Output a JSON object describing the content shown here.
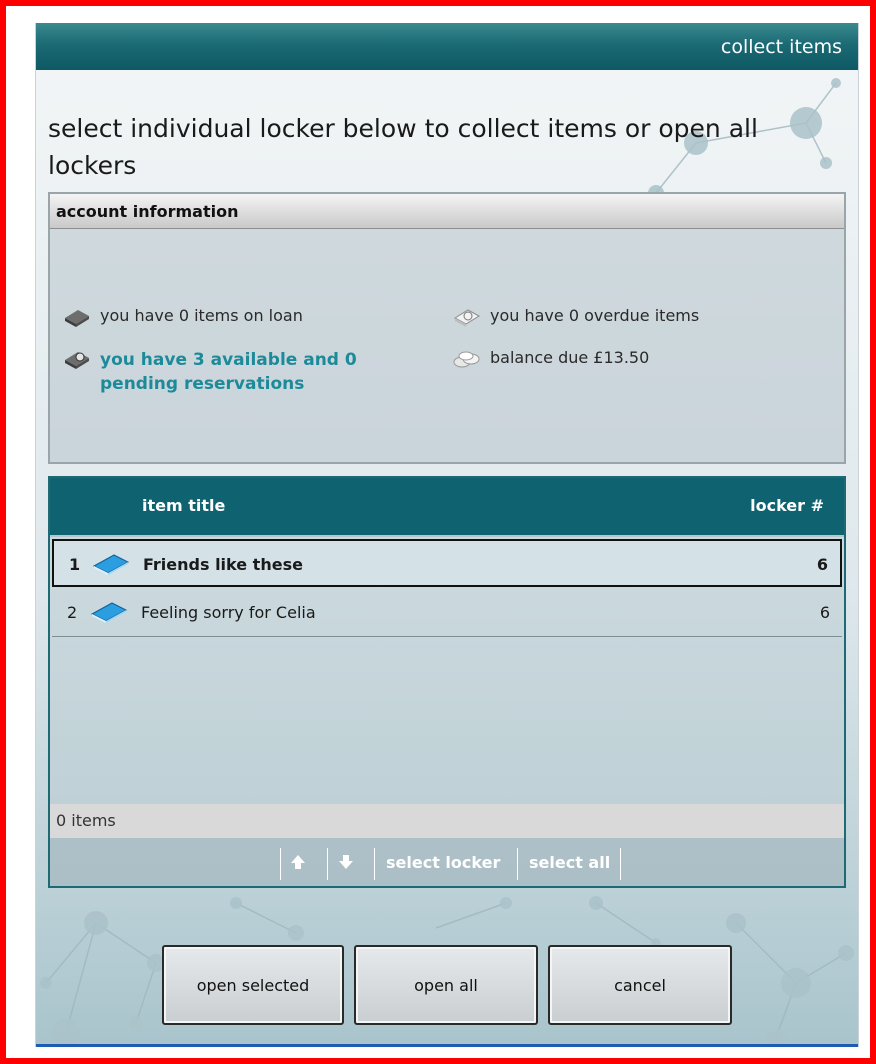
{
  "header": {
    "title": "collect items"
  },
  "instruction": "select individual locker below to collect items or open all lockers",
  "account": {
    "heading": "account information",
    "loans": "you have 0 items on loan",
    "overdue": "you have 0 overdue items",
    "reservations": "you have 3 available and 0 pending reservations",
    "balance": "balance due £13.50"
  },
  "table": {
    "col_title": "item title",
    "col_locker": "locker #",
    "rows": [
      {
        "num": "1",
        "title": "Friends like these",
        "locker": "6",
        "selected": true
      },
      {
        "num": "2",
        "title": "Feeling sorry for Celia",
        "locker": "6",
        "selected": false
      }
    ],
    "status": "0 items"
  },
  "toolbar": {
    "up_icon": "arrow-up-icon",
    "down_icon": "arrow-down-icon",
    "select_locker": "select locker",
    "select_all": "select all"
  },
  "buttons": {
    "open_selected": "open selected",
    "open_all": "open all",
    "cancel": "cancel"
  },
  "colors": {
    "accent": "#0f6370",
    "highlight_text": "#1d8a99",
    "frame": "#ff0000"
  }
}
